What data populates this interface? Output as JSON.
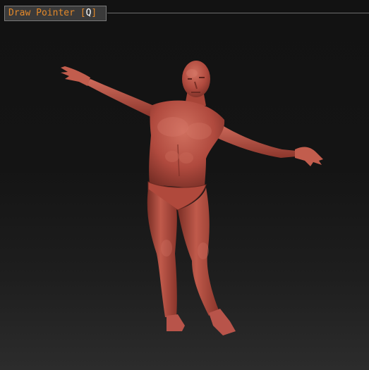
{
  "tool_tip": {
    "name": "Draw Pointer",
    "bracket_open": "[",
    "hotkey": "Q",
    "bracket_close": "]"
  },
  "model": {
    "icon": "human-figure-mesh",
    "skin_color": "#b04a3e",
    "skin_highlight": "#d8796a",
    "skin_shadow": "#6e2a22"
  },
  "colors": {
    "accent": "#e4892a",
    "background": "#111111"
  }
}
